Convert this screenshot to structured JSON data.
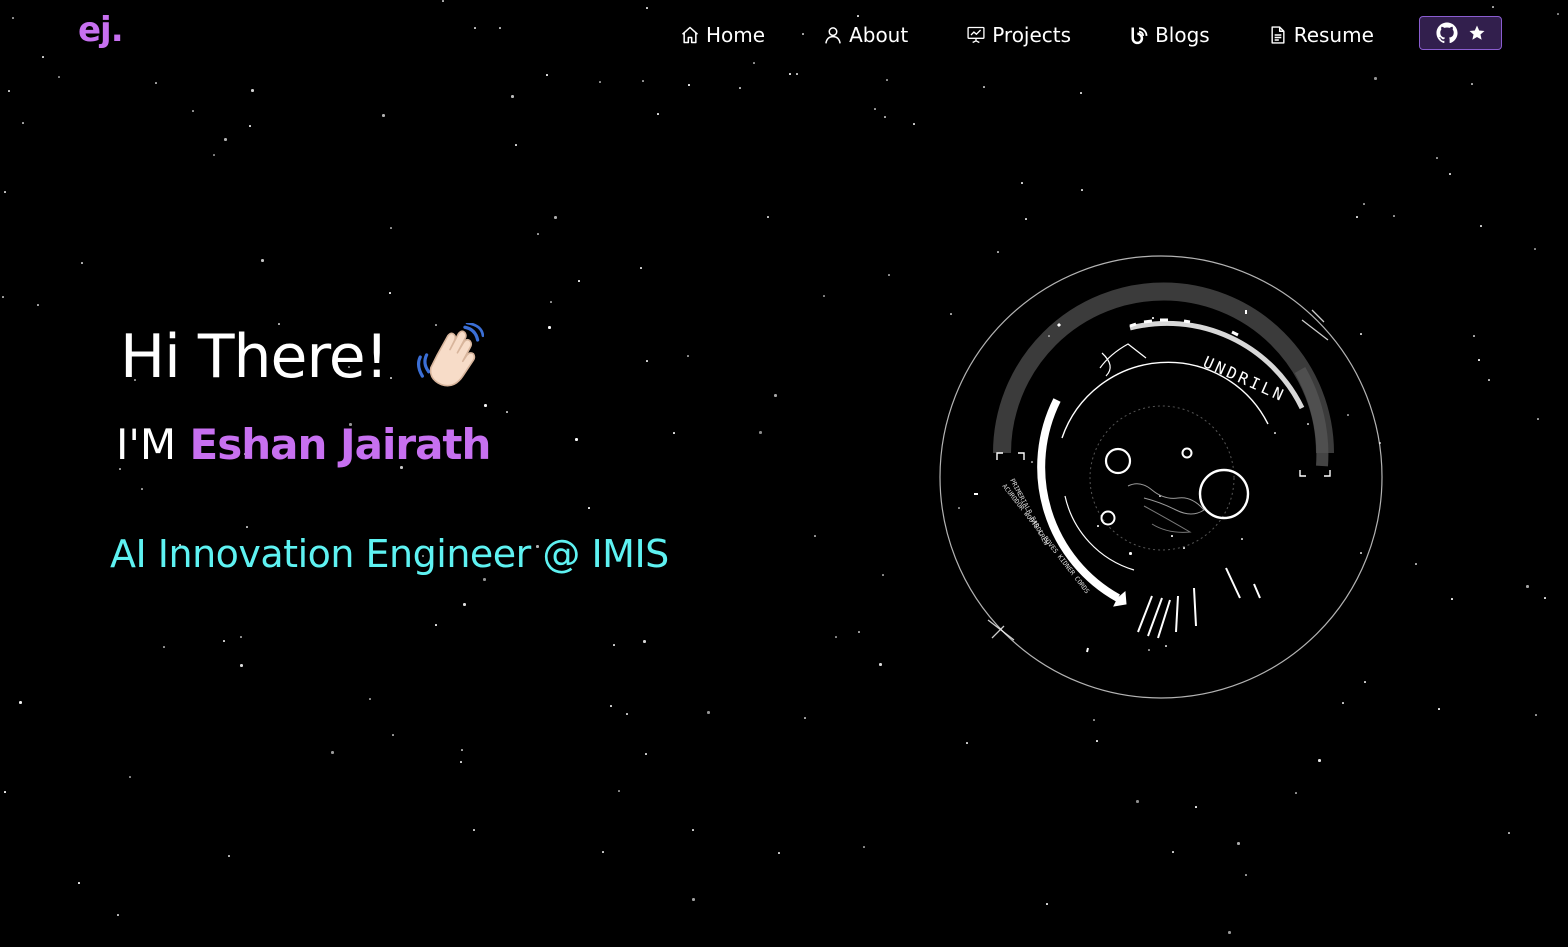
{
  "navbar": {
    "logo": "ej.",
    "items": [
      {
        "label": "Home",
        "icon": "home-icon"
      },
      {
        "label": "About",
        "icon": "user-icon"
      },
      {
        "label": "Projects",
        "icon": "presentation-icon"
      },
      {
        "label": "Blogs",
        "icon": "blog-icon"
      },
      {
        "label": "Resume",
        "icon": "document-icon"
      }
    ],
    "github_button": {
      "icons": [
        "github-icon",
        "star-icon"
      ]
    }
  },
  "hero": {
    "greeting": "Hi There!",
    "greeting_emoji": "waving-hand-icon",
    "intro_prefix": "I'M",
    "name": "Eshan Jairath",
    "role": "AI Innovation Engineer @ IMIS"
  },
  "hud": {
    "label": "UNDRILN",
    "side_text_1": "PRIMERIALR BAD CREW",
    "side_text_2": "ACURODOR WOOTSOL BOVES KIDNER CORDS"
  },
  "colors": {
    "background": "#000000",
    "accent_purple": "#c770f0",
    "accent_cyan": "#5ef2f2",
    "github_button_bg": "#321f4d"
  }
}
